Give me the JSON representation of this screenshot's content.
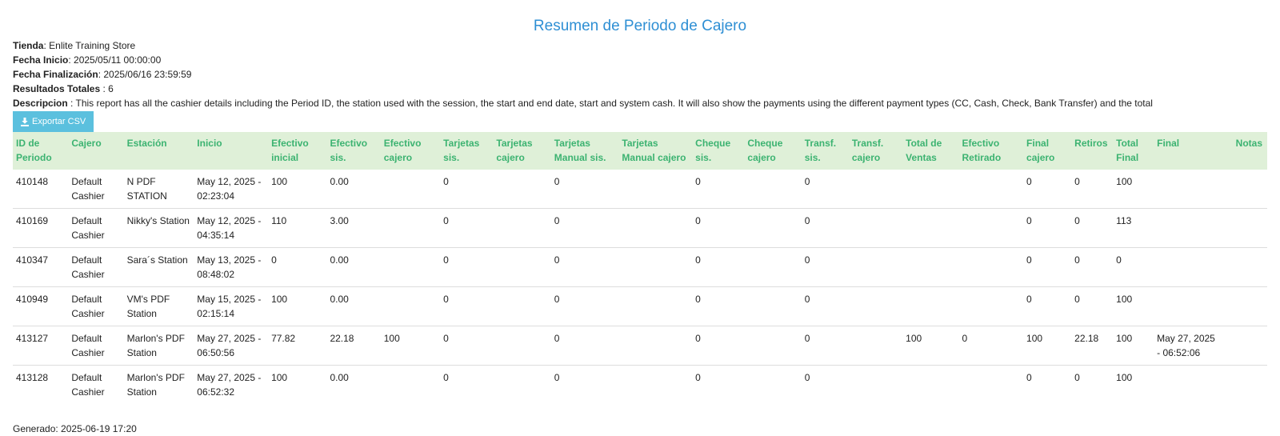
{
  "report": {
    "title": "Resumen de Periodo de Cajero",
    "store_label": "Tienda",
    "store_value": ": Enlite Training Store",
    "start_label": "Fecha Inicio",
    "start_value": ": 2025/05/11 00:00:00",
    "end_label": "Fecha Finalización",
    "end_value": ": 2025/06/16 23:59:59",
    "total_label": "Resultados Totales",
    "total_value": " : 6",
    "desc_label": "Descripcion",
    "desc_value": " : This report has all the cashier details including the Period ID, the station used with the session, the start and end date, start and system cash. It will also show the payments using the different payment types (CC, Cash, Check, Bank Transfer) and the total",
    "export_label": "Exportar CSV",
    "generated": "Generado: 2025-06-19 17:20"
  },
  "table": {
    "headers": [
      "ID de Periodo",
      "Cajero",
      "Estación",
      "Inicio",
      "Efectivo inicial",
      "Efectivo sis.",
      "Efectivo cajero",
      "Tarjetas sis.",
      "Tarjetas cajero",
      "Tarjetas Manual sis.",
      "Tarjetas Manual cajero",
      "Cheque sis.",
      "Cheque cajero",
      "Transf. sis.",
      "Transf. cajero",
      "Total de Ventas",
      "Efectivo Retirado",
      "Final cajero",
      "Retiros",
      "Total Final",
      "Final",
      "Notas"
    ],
    "rows": [
      [
        "410148",
        "Default Cashier",
        "N PDF STATION",
        "May 12, 2025 - 02:23:04",
        "100",
        "0.00",
        "",
        "0",
        "",
        "0",
        "",
        "0",
        "",
        "0",
        "",
        "",
        "",
        "0",
        "0",
        "100",
        "",
        ""
      ],
      [
        "410169",
        "Default Cashier",
        "Nikky's Station",
        "May 12, 2025 - 04:35:14",
        "110",
        "3.00",
        "",
        "0",
        "",
        "0",
        "",
        "0",
        "",
        "0",
        "",
        "",
        "",
        "0",
        "0",
        "113",
        "",
        ""
      ],
      [
        "410347",
        "Default Cashier",
        "Sara´s Station",
        "May 13, 2025 - 08:48:02",
        "0",
        "0.00",
        "",
        "0",
        "",
        "0",
        "",
        "0",
        "",
        "0",
        "",
        "",
        "",
        "0",
        "0",
        "0",
        "",
        ""
      ],
      [
        "410949",
        "Default Cashier",
        "VM's PDF Station",
        "May 15, 2025 - 02:15:14",
        "100",
        "0.00",
        "",
        "0",
        "",
        "0",
        "",
        "0",
        "",
        "0",
        "",
        "",
        "",
        "0",
        "0",
        "100",
        "",
        ""
      ],
      [
        "413127",
        "Default Cashier",
        "Marlon's PDF Station",
        "May 27, 2025 - 06:50:56",
        "77.82",
        "22.18",
        "100",
        "0",
        "",
        "0",
        "",
        "0",
        "",
        "0",
        "",
        "100",
        "0",
        "100",
        "22.18",
        "100",
        "May 27, 2025 - 06:52:06",
        ""
      ],
      [
        "413128",
        "Default Cashier",
        "Marlon's PDF Station",
        "May 27, 2025 - 06:52:32",
        "100",
        "0.00",
        "",
        "0",
        "",
        "0",
        "",
        "0",
        "",
        "0",
        "",
        "",
        "",
        "0",
        "0",
        "100",
        "",
        ""
      ]
    ]
  },
  "colors": {
    "title": "#2e8fd4",
    "header_bg": "#dff0d8",
    "header_text": "#3cb371",
    "button_bg": "#5bc0de"
  },
  "icons": {
    "export": "download-icon"
  }
}
